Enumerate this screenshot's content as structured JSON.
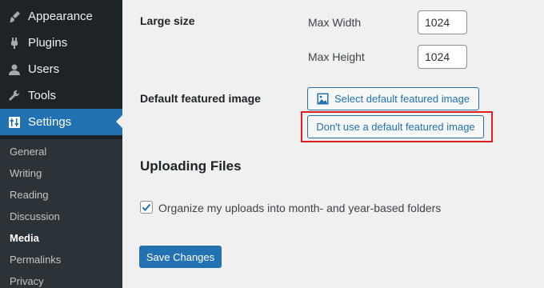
{
  "sidebar": {
    "menu": [
      {
        "label": "Appearance",
        "icon": "paintbrush-icon"
      },
      {
        "label": "Plugins",
        "icon": "plug-icon"
      },
      {
        "label": "Users",
        "icon": "user-icon"
      },
      {
        "label": "Tools",
        "icon": "wrench-icon"
      },
      {
        "label": "Settings",
        "icon": "sliders-icon",
        "active": true
      }
    ],
    "submenu": [
      {
        "label": "General"
      },
      {
        "label": "Writing"
      },
      {
        "label": "Reading"
      },
      {
        "label": "Discussion"
      },
      {
        "label": "Media",
        "current": true
      },
      {
        "label": "Permalinks"
      },
      {
        "label": "Privacy"
      }
    ]
  },
  "media": {
    "large_size_label": "Large size",
    "max_width_label": "Max Width",
    "max_width_value": "1024",
    "max_height_label": "Max Height",
    "max_height_value": "1024",
    "featured_label": "Default featured image",
    "select_featured_button": "Select default featured image",
    "dont_use_featured_button": "Don't use a default featured image",
    "uploading_title": "Uploading Files",
    "organize_uploads_label": "Organize my uploads into month- and year-based folders",
    "organize_uploads_checked": true,
    "save_button": "Save Changes"
  },
  "colors": {
    "sidebar_bg": "#1d2327",
    "accent": "#2271b1",
    "highlight": "#e02020"
  }
}
